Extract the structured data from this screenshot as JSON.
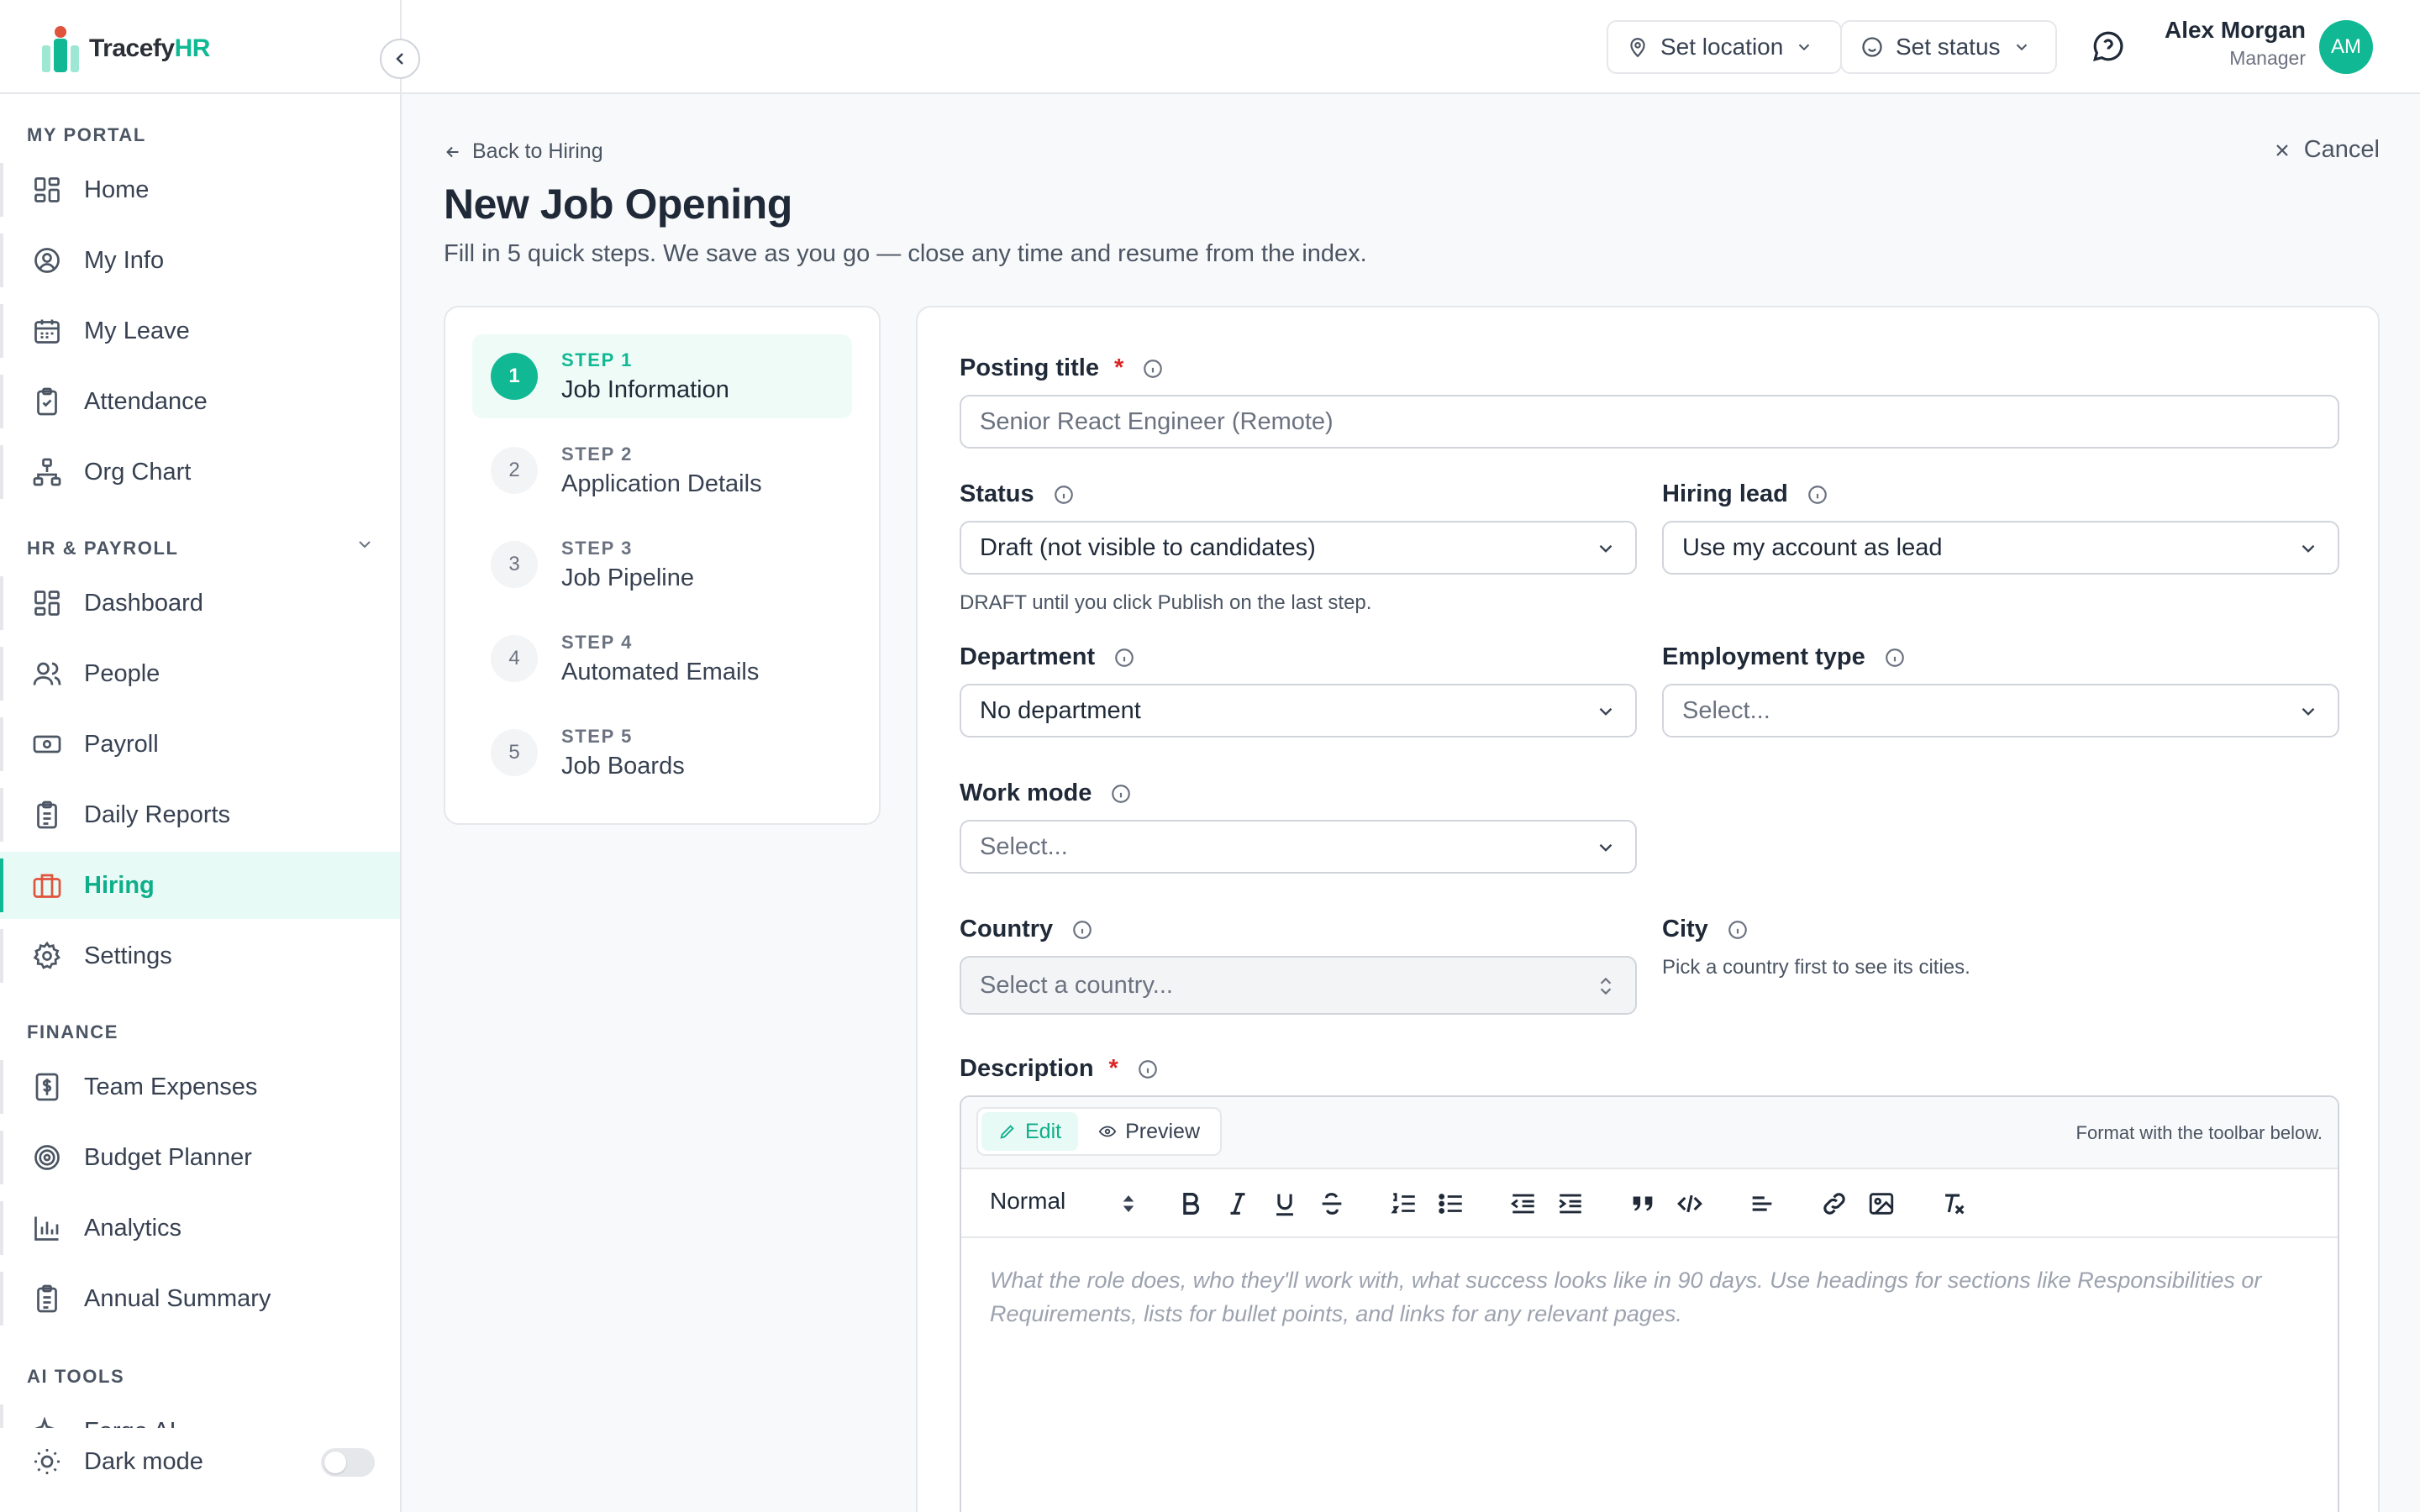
{
  "app": {
    "brand_prefix": "Tracefy",
    "brand_suffix": "HR"
  },
  "sidebar": {
    "sections": [
      {
        "label": "MY PORTAL",
        "items": [
          {
            "label": "Home",
            "icon": "grid-icon"
          },
          {
            "label": "My Info",
            "icon": "user-circle-icon"
          },
          {
            "label": "My Leave",
            "icon": "calendar-icon"
          },
          {
            "label": "Attendance",
            "icon": "clipboard-check-icon"
          },
          {
            "label": "Org Chart",
            "icon": "org-chart-icon"
          }
        ]
      },
      {
        "label": "HR & PAYROLL",
        "items": [
          {
            "label": "Dashboard",
            "icon": "grid-icon"
          },
          {
            "label": "People",
            "icon": "users-icon"
          },
          {
            "label": "Payroll",
            "icon": "banknote-icon"
          },
          {
            "label": "Daily Reports",
            "icon": "clipboard-icon"
          },
          {
            "label": "Hiring",
            "icon": "briefcase-icon",
            "active": true
          },
          {
            "label": "Settings",
            "icon": "gear-icon"
          }
        ]
      },
      {
        "label": "FINANCE",
        "items": [
          {
            "label": "Team Expenses",
            "icon": "receipt-icon"
          },
          {
            "label": "Budget Planner",
            "icon": "target-icon"
          },
          {
            "label": "Analytics",
            "icon": "bar-chart-icon"
          },
          {
            "label": "Annual Summary",
            "icon": "clipboard-icon"
          }
        ]
      },
      {
        "label": "AI TOOLS",
        "items": [
          {
            "label": "Forge AI",
            "icon": "sparkle-icon"
          }
        ]
      }
    ],
    "dark_mode_label": "Dark mode",
    "dark_mode_on": false
  },
  "topbar": {
    "location_label": "Set location",
    "status_label": "Set status",
    "user_name": "Alex Morgan",
    "user_role": "Manager",
    "avatar_initials": "AM"
  },
  "page": {
    "back_label": "Back to Hiring",
    "cancel_label": "Cancel",
    "title": "New Job Opening",
    "subtitle": "Fill in 5 quick steps. We save as you go — close any time and resume from the index."
  },
  "steps": [
    {
      "num": "1",
      "label": "STEP 1",
      "name": "Job Information",
      "active": true
    },
    {
      "num": "2",
      "label": "STEP 2",
      "name": "Application Details"
    },
    {
      "num": "3",
      "label": "STEP 3",
      "name": "Job Pipeline"
    },
    {
      "num": "4",
      "label": "STEP 4",
      "name": "Automated Emails"
    },
    {
      "num": "5",
      "label": "STEP 5",
      "name": "Job Boards"
    }
  ],
  "form": {
    "posting_title": {
      "label": "Posting title",
      "required": "*",
      "placeholder": "Senior React Engineer (Remote)"
    },
    "status": {
      "label": "Status",
      "value": "Draft (not visible to candidates)",
      "hint": "DRAFT until you click Publish on the last step."
    },
    "hiring_lead": {
      "label": "Hiring lead",
      "value": "Use my account as lead"
    },
    "department": {
      "label": "Department",
      "value": "No department"
    },
    "employment_type": {
      "label": "Employment type",
      "placeholder": "Select..."
    },
    "work_mode": {
      "label": "Work mode",
      "placeholder": "Select..."
    },
    "country": {
      "label": "Country",
      "placeholder": "Select a country..."
    },
    "city": {
      "label": "City",
      "hint": "Pick a country first to see its cities."
    },
    "description": {
      "label": "Description",
      "required": "*",
      "edit_tab": "Edit",
      "preview_tab": "Preview",
      "format_hint": "Format with the toolbar below.",
      "heading_select": "Normal",
      "placeholder": "What the role does, who they'll work with, what success looks like in 90 days. Use headings for sections like Responsibilities or Requirements, lists for bullet points, and links for any relevant pages."
    }
  },
  "colors": {
    "accent": "#10b994",
    "active_bg": "#e8faf5",
    "hiring_icon": "#e0533d",
    "required": "#dc2626"
  }
}
